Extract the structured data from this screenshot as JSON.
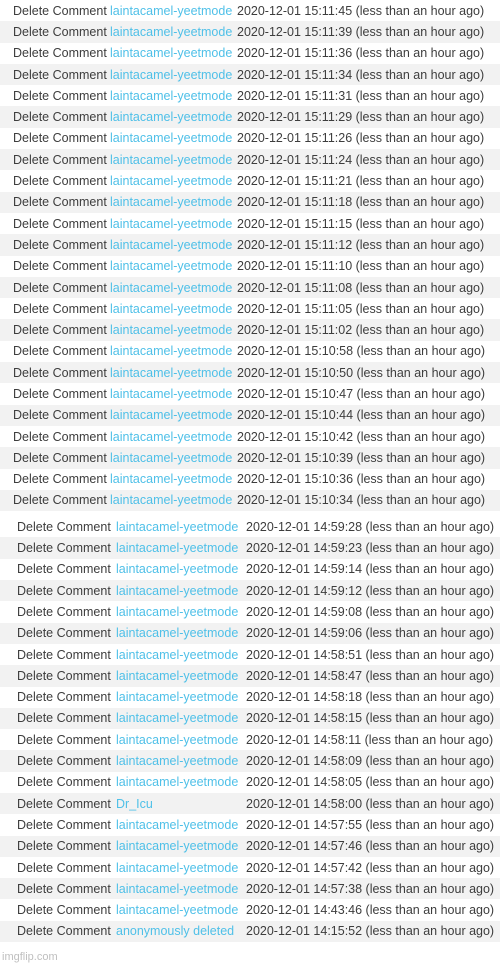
{
  "page": {
    "watermark": "imgflip.com",
    "link_color": "#4fc0e8",
    "text_color": "#3d3d3d",
    "row_alt_color": "#f2f2f2",
    "row_base_color": "#ffffff"
  },
  "blocks": [
    {
      "name": "comment-list-upper",
      "rows": [
        {
          "action": "Delete Comment",
          "user": "laintacamel-yeetmode",
          "timestamp": "2020-12-01 15:11:45 (less than an hour ago)"
        },
        {
          "action": "Delete Comment",
          "user": "laintacamel-yeetmode",
          "timestamp": "2020-12-01 15:11:39 (less than an hour ago)"
        },
        {
          "action": "Delete Comment",
          "user": "laintacamel-yeetmode",
          "timestamp": "2020-12-01 15:11:36 (less than an hour ago)"
        },
        {
          "action": "Delete Comment",
          "user": "laintacamel-yeetmode",
          "timestamp": "2020-12-01 15:11:34 (less than an hour ago)"
        },
        {
          "action": "Delete Comment",
          "user": "laintacamel-yeetmode",
          "timestamp": "2020-12-01 15:11:31 (less than an hour ago)"
        },
        {
          "action": "Delete Comment",
          "user": "laintacamel-yeetmode",
          "timestamp": "2020-12-01 15:11:29 (less than an hour ago)"
        },
        {
          "action": "Delete Comment",
          "user": "laintacamel-yeetmode",
          "timestamp": "2020-12-01 15:11:26 (less than an hour ago)"
        },
        {
          "action": "Delete Comment",
          "user": "laintacamel-yeetmode",
          "timestamp": "2020-12-01 15:11:24 (less than an hour ago)"
        },
        {
          "action": "Delete Comment",
          "user": "laintacamel-yeetmode",
          "timestamp": "2020-12-01 15:11:21 (less than an hour ago)"
        },
        {
          "action": "Delete Comment",
          "user": "laintacamel-yeetmode",
          "timestamp": "2020-12-01 15:11:18 (less than an hour ago)"
        },
        {
          "action": "Delete Comment",
          "user": "laintacamel-yeetmode",
          "timestamp": "2020-12-01 15:11:15 (less than an hour ago)"
        },
        {
          "action": "Delete Comment",
          "user": "laintacamel-yeetmode",
          "timestamp": "2020-12-01 15:11:12 (less than an hour ago)"
        },
        {
          "action": "Delete Comment",
          "user": "laintacamel-yeetmode",
          "timestamp": "2020-12-01 15:11:10 (less than an hour ago)"
        },
        {
          "action": "Delete Comment",
          "user": "laintacamel-yeetmode",
          "timestamp": "2020-12-01 15:11:08 (less than an hour ago)"
        },
        {
          "action": "Delete Comment",
          "user": "laintacamel-yeetmode",
          "timestamp": "2020-12-01 15:11:05 (less than an hour ago)"
        },
        {
          "action": "Delete Comment",
          "user": "laintacamel-yeetmode",
          "timestamp": "2020-12-01 15:11:02 (less than an hour ago)"
        },
        {
          "action": "Delete Comment",
          "user": "laintacamel-yeetmode",
          "timestamp": "2020-12-01 15:10:58 (less than an hour ago)"
        },
        {
          "action": "Delete Comment",
          "user": "laintacamel-yeetmode",
          "timestamp": "2020-12-01 15:10:50 (less than an hour ago)"
        },
        {
          "action": "Delete Comment",
          "user": "laintacamel-yeetmode",
          "timestamp": "2020-12-01 15:10:47 (less than an hour ago)"
        },
        {
          "action": "Delete Comment",
          "user": "laintacamel-yeetmode",
          "timestamp": "2020-12-01 15:10:44 (less than an hour ago)"
        },
        {
          "action": "Delete Comment",
          "user": "laintacamel-yeetmode",
          "timestamp": "2020-12-01 15:10:42 (less than an hour ago)"
        },
        {
          "action": "Delete Comment",
          "user": "laintacamel-yeetmode",
          "timestamp": "2020-12-01 15:10:39 (less than an hour ago)"
        },
        {
          "action": "Delete Comment",
          "user": "laintacamel-yeetmode",
          "timestamp": "2020-12-01 15:10:36 (less than an hour ago)"
        },
        {
          "action": "Delete Comment",
          "user": "laintacamel-yeetmode",
          "timestamp": "2020-12-01 15:10:34 (less than an hour ago)"
        }
      ]
    },
    {
      "name": "comment-list-lower",
      "rows": [
        {
          "action": "Delete Comment",
          "user": "laintacamel-yeetmode",
          "timestamp": "2020-12-01 14:59:28 (less than an hour ago)"
        },
        {
          "action": "Delete Comment",
          "user": "laintacamel-yeetmode",
          "timestamp": "2020-12-01 14:59:23 (less than an hour ago)"
        },
        {
          "action": "Delete Comment",
          "user": "laintacamel-yeetmode",
          "timestamp": "2020-12-01 14:59:14 (less than an hour ago)"
        },
        {
          "action": "Delete Comment",
          "user": "laintacamel-yeetmode",
          "timestamp": "2020-12-01 14:59:12 (less than an hour ago)"
        },
        {
          "action": "Delete Comment",
          "user": "laintacamel-yeetmode",
          "timestamp": "2020-12-01 14:59:08 (less than an hour ago)"
        },
        {
          "action": "Delete Comment",
          "user": "laintacamel-yeetmode",
          "timestamp": "2020-12-01 14:59:06 (less than an hour ago)"
        },
        {
          "action": "Delete Comment",
          "user": "laintacamel-yeetmode",
          "timestamp": "2020-12-01 14:58:51 (less than an hour ago)"
        },
        {
          "action": "Delete Comment",
          "user": "laintacamel-yeetmode",
          "timestamp": "2020-12-01 14:58:47 (less than an hour ago)"
        },
        {
          "action": "Delete Comment",
          "user": "laintacamel-yeetmode",
          "timestamp": "2020-12-01 14:58:18 (less than an hour ago)"
        },
        {
          "action": "Delete Comment",
          "user": "laintacamel-yeetmode",
          "timestamp": "2020-12-01 14:58:15 (less than an hour ago)"
        },
        {
          "action": "Delete Comment",
          "user": "laintacamel-yeetmode",
          "timestamp": "2020-12-01 14:58:11 (less than an hour ago)"
        },
        {
          "action": "Delete Comment",
          "user": "laintacamel-yeetmode",
          "timestamp": "2020-12-01 14:58:09 (less than an hour ago)"
        },
        {
          "action": "Delete Comment",
          "user": "laintacamel-yeetmode",
          "timestamp": "2020-12-01 14:58:05 (less than an hour ago)"
        },
        {
          "action": "Delete Comment",
          "user": "Dr_Icu",
          "timestamp": "2020-12-01 14:58:00 (less than an hour ago)"
        },
        {
          "action": "Delete Comment",
          "user": "laintacamel-yeetmode",
          "timestamp": "2020-12-01 14:57:55 (less than an hour ago)"
        },
        {
          "action": "Delete Comment",
          "user": "laintacamel-yeetmode",
          "timestamp": "2020-12-01 14:57:46 (less than an hour ago)"
        },
        {
          "action": "Delete Comment",
          "user": "laintacamel-yeetmode",
          "timestamp": "2020-12-01 14:57:42 (less than an hour ago)"
        },
        {
          "action": "Delete Comment",
          "user": "laintacamel-yeetmode",
          "timestamp": "2020-12-01 14:57:38 (less than an hour ago)"
        },
        {
          "action": "Delete Comment",
          "user": "laintacamel-yeetmode",
          "timestamp": "2020-12-01 14:43:46 (less than an hour ago)"
        },
        {
          "action": "Delete Comment",
          "user": "anonymously deleted",
          "timestamp": "2020-12-01 14:15:52 (less than an hour ago)"
        }
      ]
    }
  ]
}
